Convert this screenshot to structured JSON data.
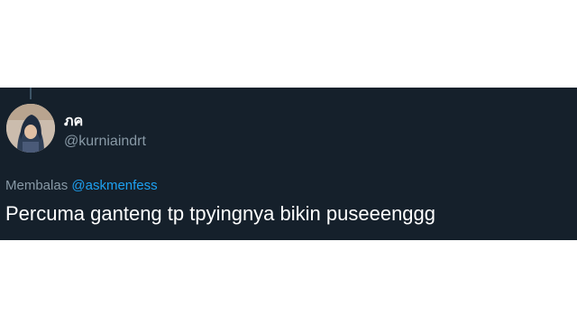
{
  "tweet": {
    "display_name": "ภค",
    "handle": "@kurniaindrt",
    "reply_prefix": "Membalas",
    "reply_mention": "@askmenfess",
    "text": "Percuma ganteng tp tpyingnya bikin puseeenggg"
  },
  "colors": {
    "card_background": "#15202b",
    "primary_text": "#ffffff",
    "secondary_text": "#8899a6",
    "mention": "#1da1f2"
  }
}
